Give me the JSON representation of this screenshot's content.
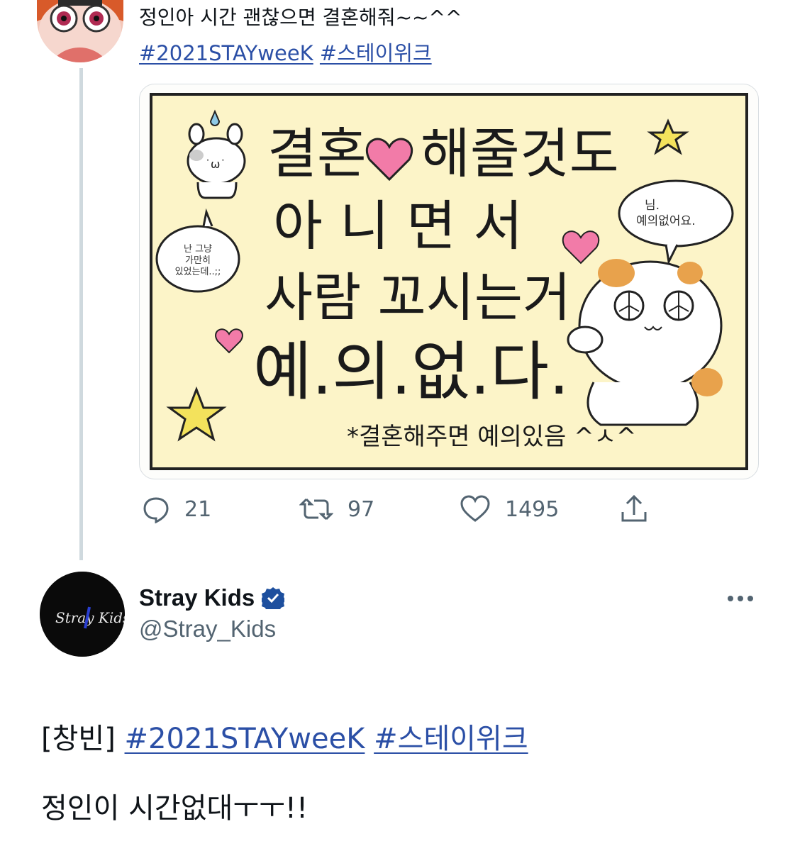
{
  "reply_tweet": {
    "text": "정인아 시간 괜찮으면 결혼해줘~~^^",
    "hashtags": [
      "#2021STAYweeK",
      "#스테이위크"
    ],
    "image": {
      "main_lines": [
        "결혼",
        "해줄것도",
        "아 니 면 서",
        "사람 꼬시는거",
        "예.의.없.다."
      ],
      "footnote": "*결혼해주면 예의있음 ^ㅅ^",
      "bubble_left": [
        "난 그냥",
        "가만히",
        "있었는데..;;"
      ],
      "bubble_right": [
        "님.",
        "예의없어요."
      ]
    },
    "actions": {
      "reply_count": "21",
      "retweet_count": "97",
      "like_count": "1495"
    }
  },
  "main_tweet": {
    "display_name": "Stray Kids",
    "verified": true,
    "handle": "@Stray_Kids",
    "avatar_logo_text": "Stray Kids",
    "body_prefix": "[창빈]",
    "hashtags": [
      "#2021STAYweeK",
      "#스테이위크"
    ],
    "body_line2": "정인이 시간없대ㅜㅜ!!"
  },
  "colors": {
    "hashtag": "#2b4fa6",
    "muted": "#536471",
    "verified": "#1d4f9e",
    "card_bg": "#fcf4c8",
    "heart": "#f27ba8",
    "star": "#f3e25c"
  },
  "icons": [
    "reply-icon",
    "retweet-icon",
    "like-icon",
    "share-icon",
    "verified-badge-icon",
    "more-options-icon"
  ]
}
